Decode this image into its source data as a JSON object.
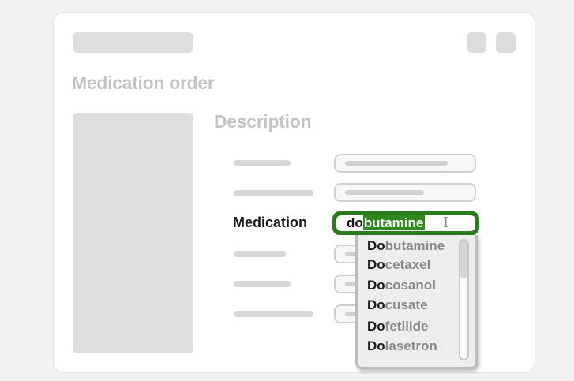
{
  "page_title": "Medication order",
  "section_title": "Description",
  "medication_field": {
    "label": "Medication",
    "typed": "do",
    "completion": "butamine"
  },
  "suggestions": [
    {
      "prefix": "Do",
      "rest": "butamine"
    },
    {
      "prefix": "Do",
      "rest": "cetaxel"
    },
    {
      "prefix": "Do",
      "rest": "cosanol"
    },
    {
      "prefix": "Do",
      "rest": "cusate"
    },
    {
      "prefix": "Do",
      "rest": "fetilide"
    },
    {
      "prefix": "Do",
      "rest": "lasetron"
    }
  ],
  "colors": {
    "accent_green": "#2c7a1f",
    "placeholder_gray": "#dedede"
  },
  "icons": {
    "text_cursor": "text-cursor-icon"
  }
}
